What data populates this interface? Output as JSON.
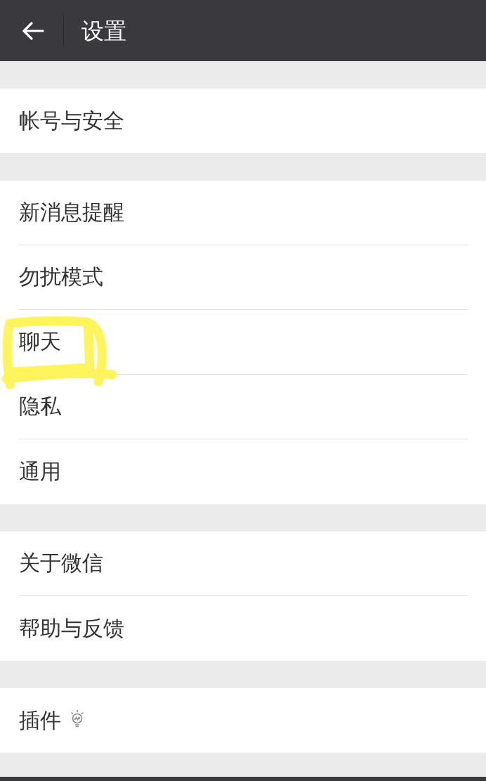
{
  "header": {
    "title": "设置"
  },
  "groups": [
    {
      "items": [
        {
          "label": "帐号与安全",
          "kind": "plain",
          "highlighted": false
        }
      ]
    },
    {
      "items": [
        {
          "label": "新消息提醒",
          "kind": "plain",
          "highlighted": false
        },
        {
          "label": "勿扰模式",
          "kind": "plain",
          "highlighted": false
        },
        {
          "label": "聊天",
          "kind": "plain",
          "highlighted": true
        },
        {
          "label": "隐私",
          "kind": "plain",
          "highlighted": false
        },
        {
          "label": "通用",
          "kind": "plain",
          "highlighted": false
        }
      ]
    },
    {
      "items": [
        {
          "label": "关于微信",
          "kind": "plain",
          "highlighted": false
        },
        {
          "label": "帮助与反馈",
          "kind": "plain",
          "highlighted": false
        }
      ]
    },
    {
      "items": [
        {
          "label": "插件",
          "kind": "tip",
          "highlighted": false
        }
      ]
    }
  ]
}
